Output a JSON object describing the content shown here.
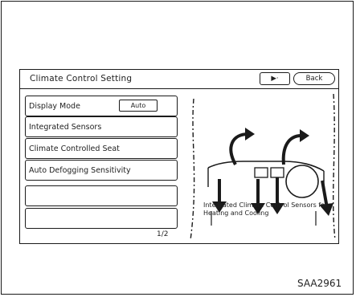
{
  "screen": {
    "title": "Climate Control Setting",
    "header_buttons": {
      "info": "▶·",
      "back": "Back"
    },
    "menu": [
      {
        "label": "Display Mode",
        "value": "Auto"
      },
      {
        "label": "Integrated Sensors"
      },
      {
        "label": "Climate Controlled Seat"
      },
      {
        "label": "Auto Defogging Sensitivity"
      },
      {
        "label": ""
      },
      {
        "label": ""
      }
    ],
    "scroll_indicator": "1/2",
    "description": "Integrated Climate Control Sensors for Heating and Cooling"
  },
  "figure_code": "SAA2961"
}
